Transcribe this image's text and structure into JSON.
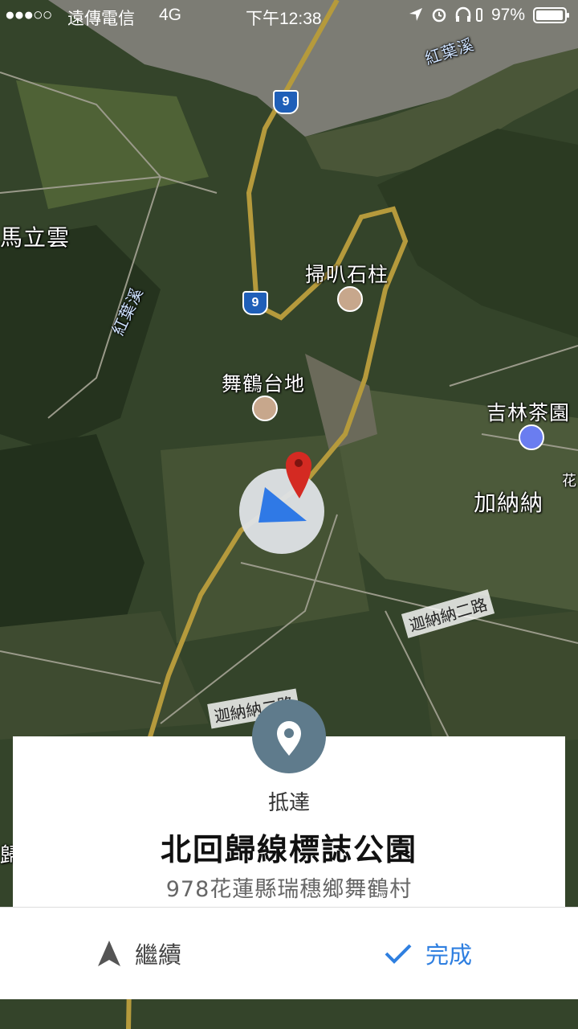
{
  "status_bar": {
    "signal": "●●●○○",
    "carrier": "遠傳電信",
    "network": "4G",
    "time": "下午12:38",
    "battery_percent": "97%",
    "battery_level": 0.97
  },
  "map": {
    "place_labels": {
      "saoba": "掃叭石柱",
      "wuhe": "舞鶴台地",
      "jilin": "吉林茶園",
      "janana": "加納納",
      "malyun": "馬立雲",
      "edge_hua": "花",
      "edge_gui": "歸"
    },
    "water_labels": {
      "hongye_top": "紅葉溪",
      "hongye_side": "紅葉溪"
    },
    "road_labels": {
      "road_a": "迦納納二路",
      "road_b": "迦納納二路"
    },
    "highway_shields": [
      "9",
      "9"
    ]
  },
  "arrival_card": {
    "icon": "location-pin-icon",
    "arrive_label": "抵達",
    "place_name": "北回歸線標誌公園",
    "address": "978花蓮縣瑞穗鄉舞鶴村"
  },
  "bottom_bar": {
    "continue_label": "繼續",
    "continue_icon": "navigation-arrow-icon",
    "done_label": "完成",
    "done_icon": "checkmark-icon",
    "accent_color": "#2f7fe0"
  }
}
